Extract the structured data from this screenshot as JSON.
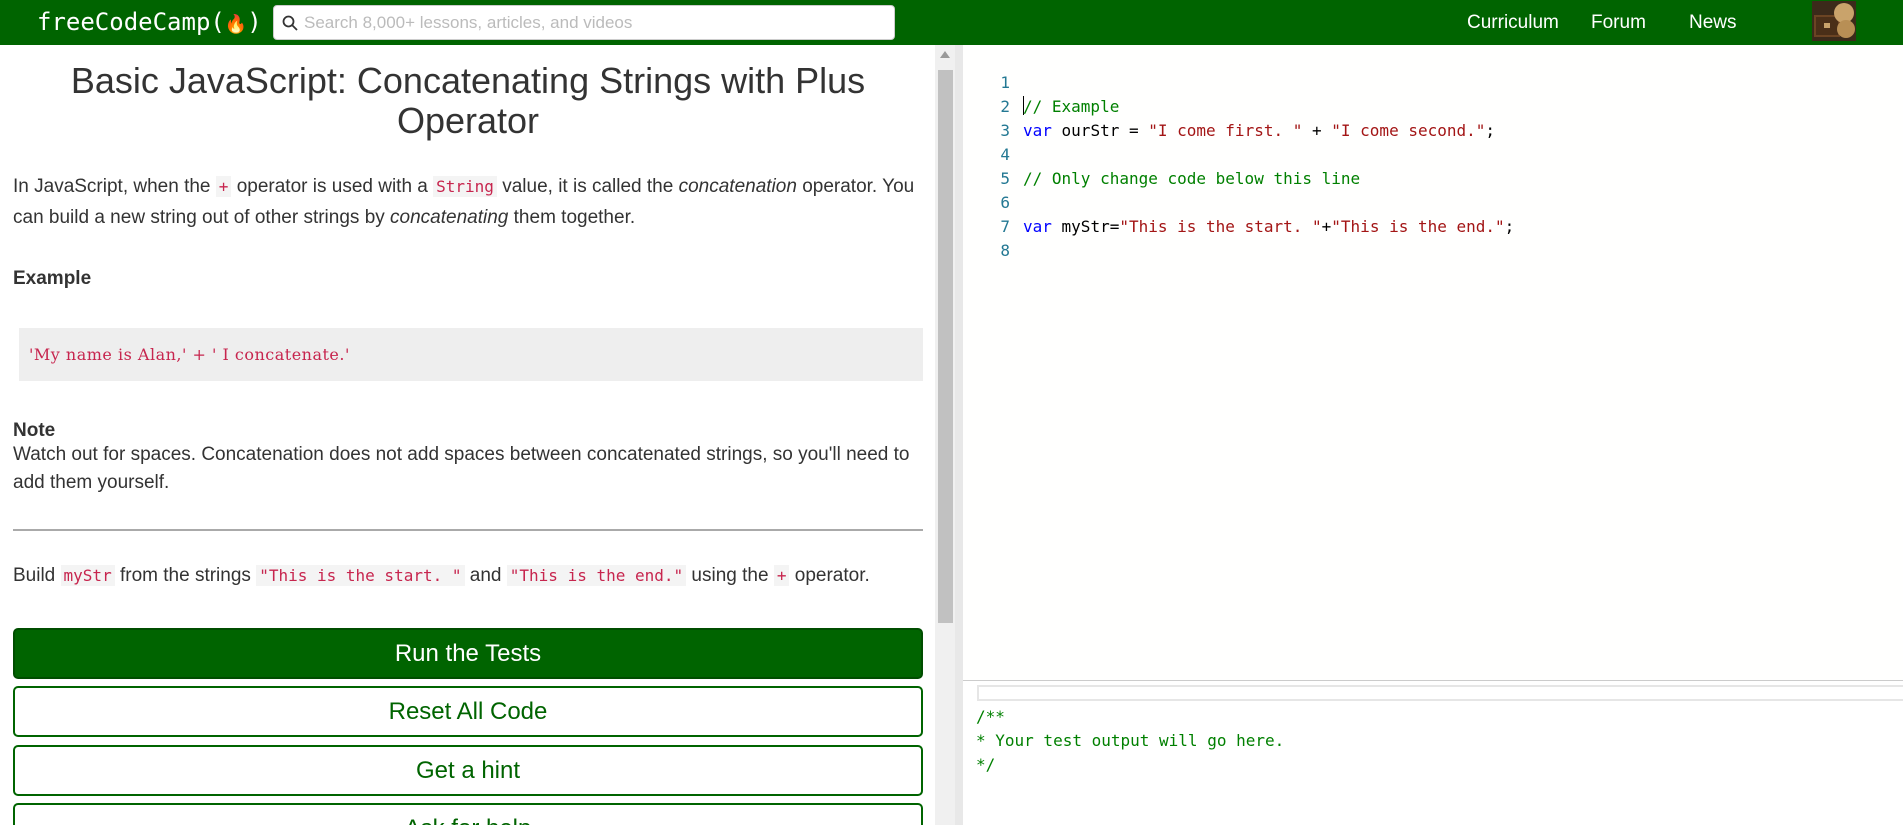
{
  "navbar": {
    "logo_text": "freeCodeCamp(",
    "logo_close": ")",
    "logo_icon": "flame-icon",
    "search_placeholder": "Search 8,000+ lessons, articles, and videos",
    "links": [
      "Curriculum",
      "Forum",
      "News"
    ],
    "background": "#006400"
  },
  "lesson": {
    "title": "Basic JavaScript: Concatenating Strings with Plus Operator",
    "intro": {
      "t1": "In JavaScript, when the ",
      "code_plus": "+",
      "t2": " operator is used with a ",
      "code_string": "String",
      "t3": " value, it is called the ",
      "em1": "concatenation",
      "t4": " operator. You can build a new string out of other strings by ",
      "em2": "concatenating",
      "t5": " them together."
    },
    "example_heading": "Example",
    "example_code": "'My name is Alan,' + ' I concatenate.'",
    "note_heading": "Note",
    "note_text": "Watch out for spaces. Concatenation does not add spaces between concatenated strings, so you'll need to add them yourself.",
    "task": {
      "t1": "Build ",
      "code_var": "myStr",
      "t2": " from the strings ",
      "code_s1": "\"This is the start. \"",
      "t3": " and ",
      "code_s2": "\"This is the end.\"",
      "t4": " using the ",
      "code_plus": "+",
      "t5": " operator."
    },
    "buttons": {
      "run": "Run the Tests",
      "reset": "Reset All Code",
      "hint": "Get a hint",
      "help": "Ask for help"
    },
    "accent": "#006400"
  },
  "editor": {
    "line_numbers": [
      "1",
      "2",
      "3",
      "4",
      "5",
      "6",
      "7",
      "8"
    ],
    "line1_comment": "// Example",
    "line2": {
      "kw": "var",
      "rest": " ourStr = ",
      "s1": "\"I come first. \"",
      "op": " + ",
      "s2": "\"I come second.\"",
      "end": ";"
    },
    "line4_comment": "// Only change code below this line",
    "line6": {
      "kw": "var",
      "rest": " myStr=",
      "s1": "\"This is the start. \"",
      "op": "+",
      "s2": "\"This is the end.\"",
      "end": ";"
    }
  },
  "output": {
    "lines": [
      "/**",
      "* Your test output will go here.",
      "*/"
    ]
  }
}
